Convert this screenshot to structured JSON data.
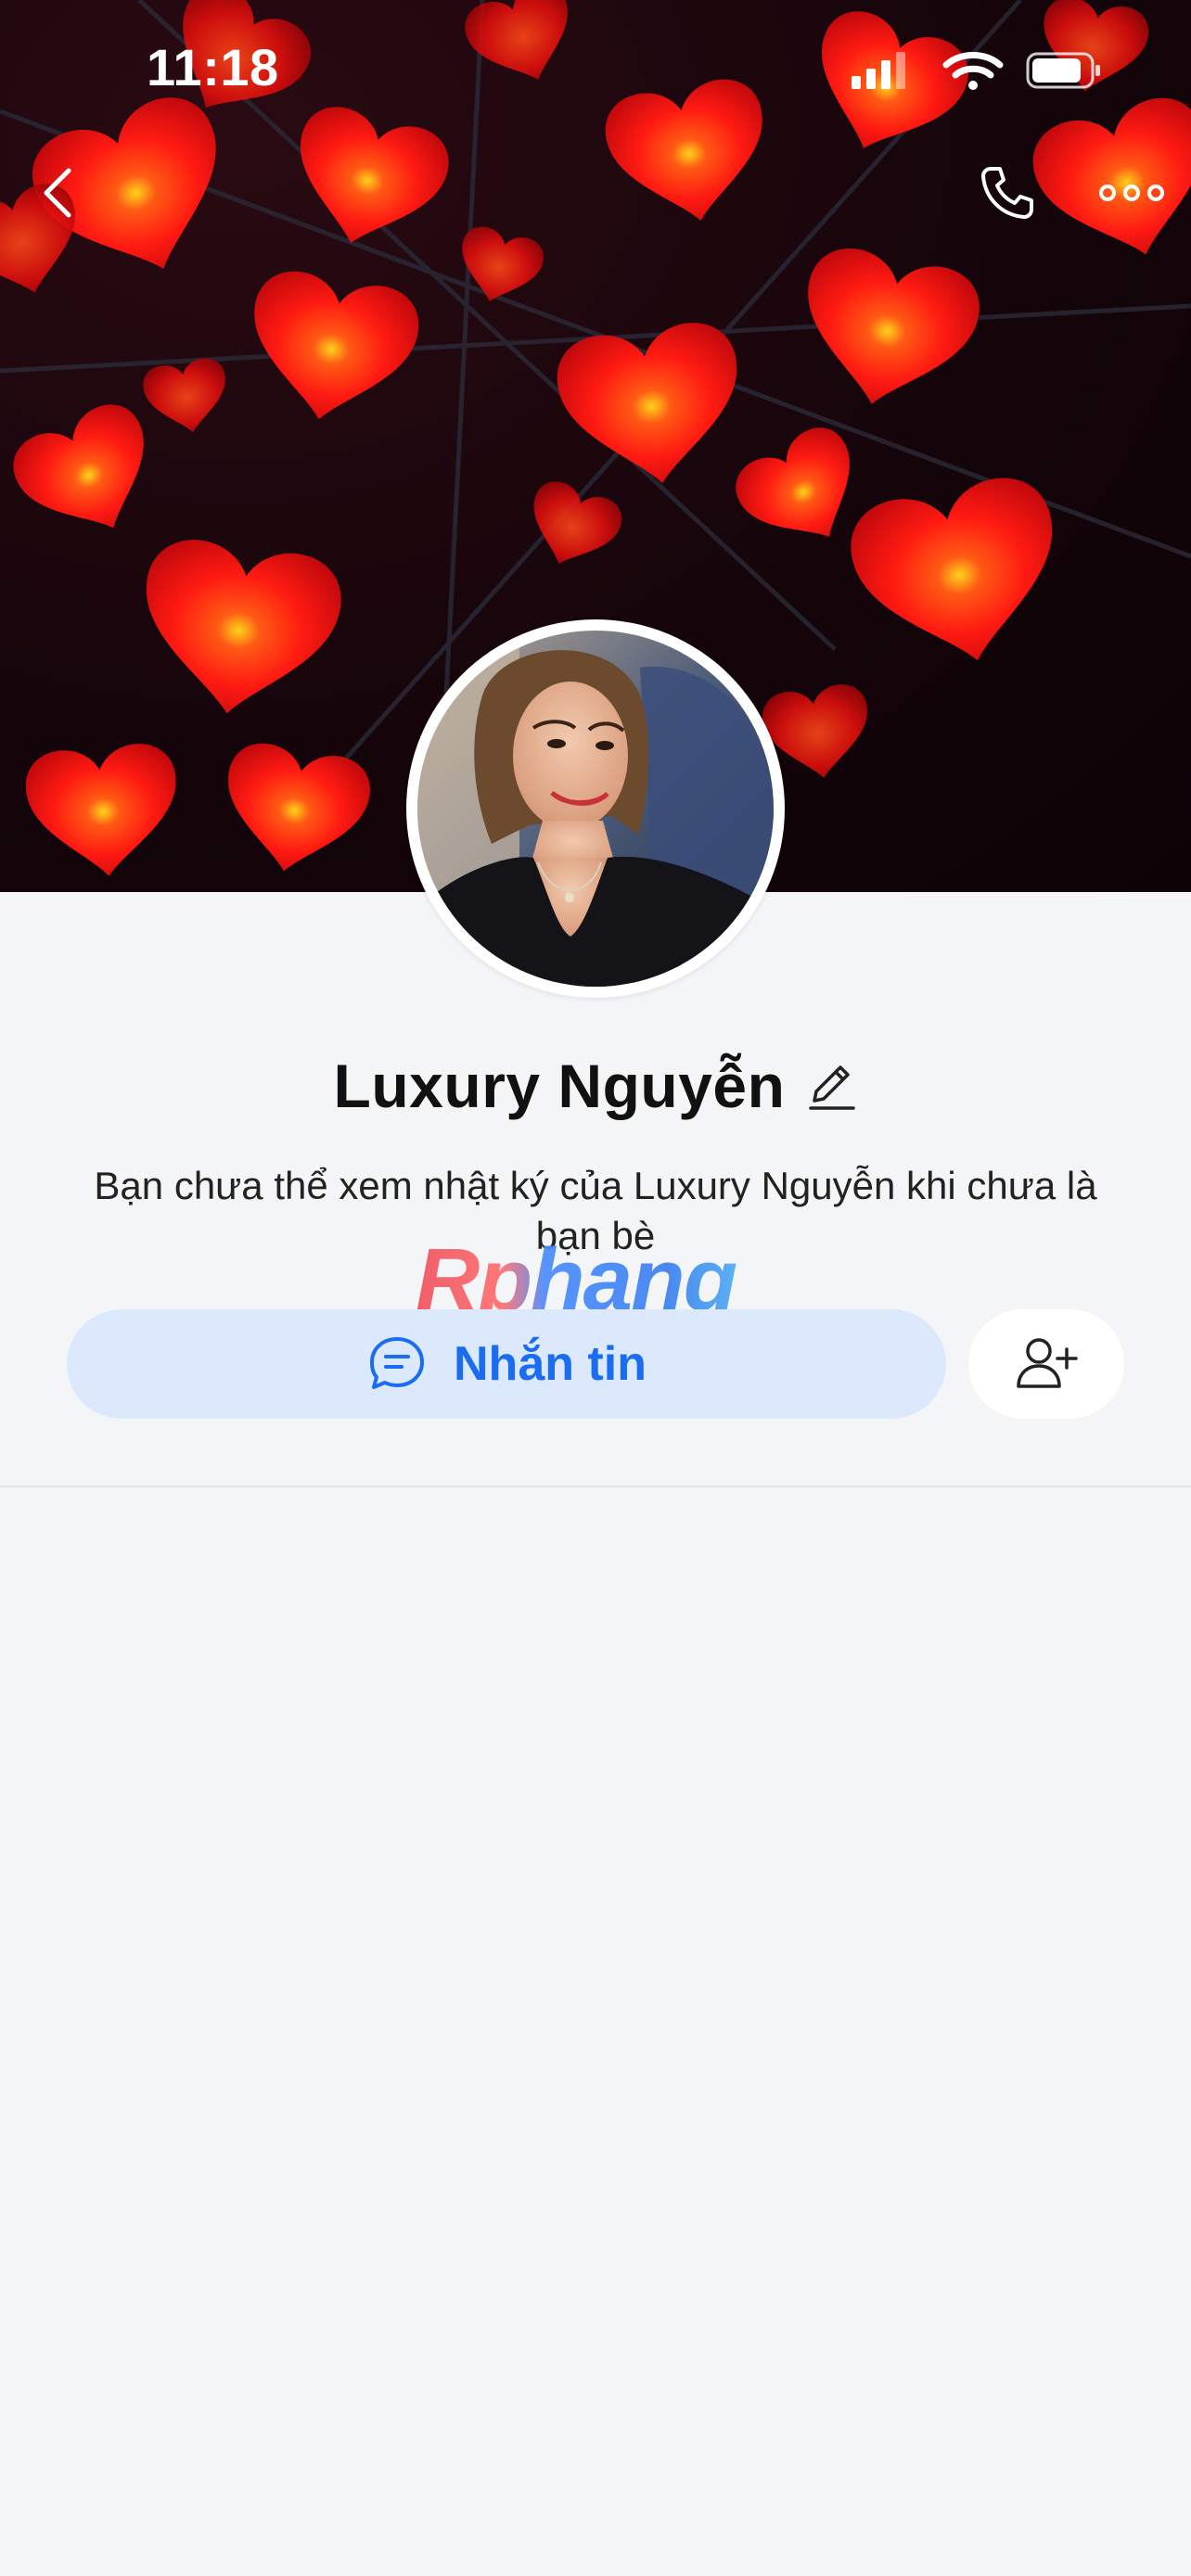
{
  "status_bar": {
    "time": "11:18",
    "icons": [
      "signal-icon",
      "wifi-icon",
      "battery-icon"
    ]
  },
  "nav": {
    "icons": [
      "chevron-left-icon",
      "phone-icon",
      "more-horizontal-icon"
    ]
  },
  "profile": {
    "name": "Luxury Nguyễn",
    "bio": "Bạn chưa thể xem nhật ký của Luxury Nguyễn khi chưa là bạn bè"
  },
  "actions": {
    "message_label": "Nhắn tin",
    "message_icon": "chat-bubble-icon",
    "add_friend_icon": "add-user-icon"
  },
  "watermark": "Rphang",
  "colors": {
    "accent": "#1a6cf0",
    "message_button_bg": "#dce9fd",
    "page_bg": "#f4f5f7",
    "cover_lantern": "#ff1a12"
  }
}
